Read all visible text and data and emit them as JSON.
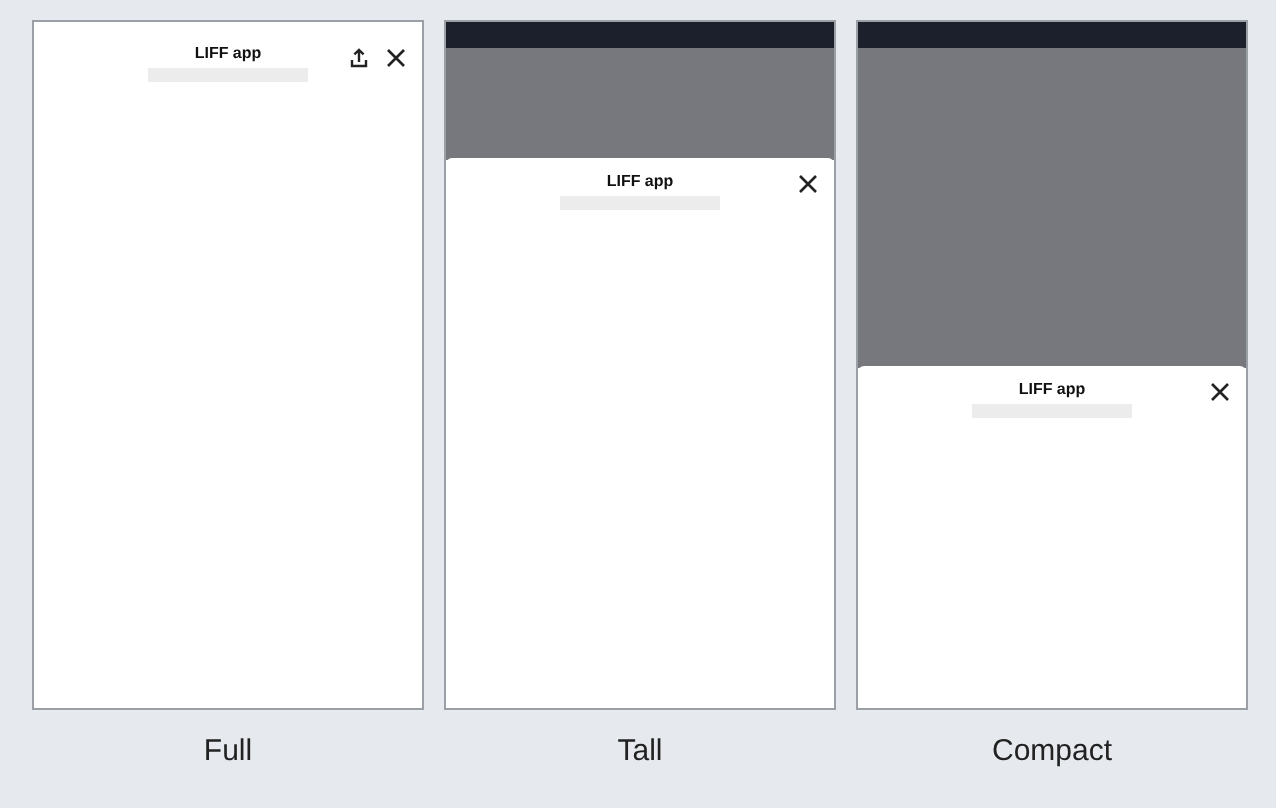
{
  "views": [
    {
      "kind": "full",
      "title": "LIFF app",
      "caption": "Full"
    },
    {
      "kind": "tall",
      "title": "LIFF app",
      "caption": "Tall"
    },
    {
      "kind": "compact",
      "title": "LIFF app",
      "caption": "Compact"
    }
  ]
}
